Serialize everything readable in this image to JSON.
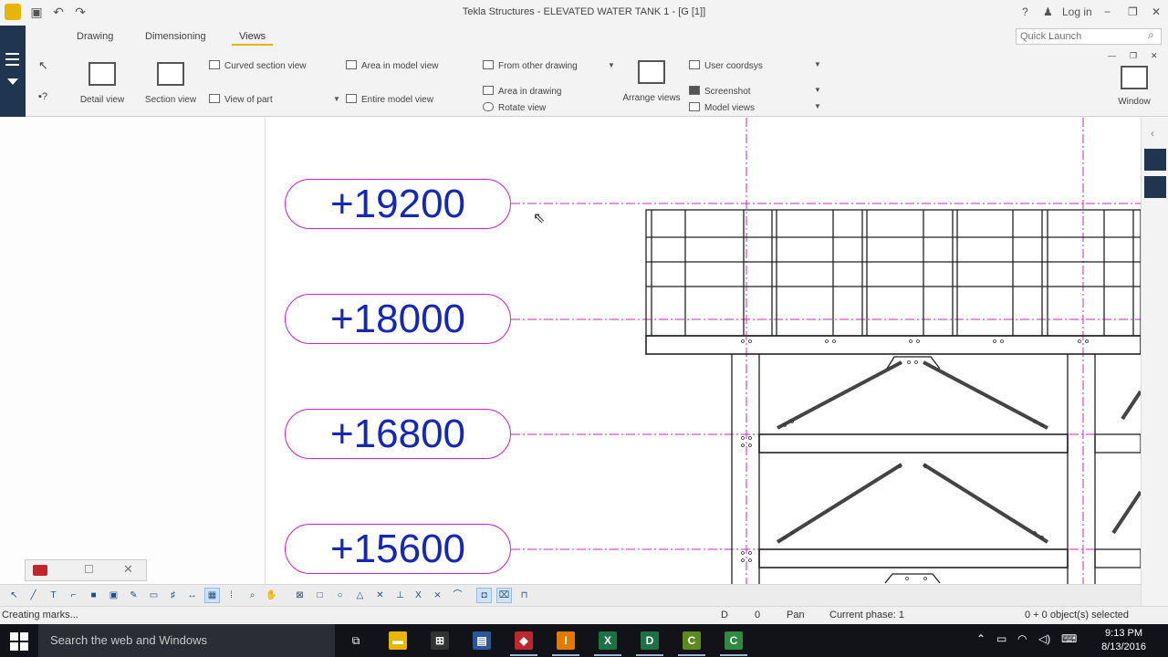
{
  "window": {
    "title": "Tekla Structures - ELEVATED WATER TANK 1 - [G  [1]]",
    "help": "?",
    "login": "Log in"
  },
  "ribbon": {
    "tabs": [
      "Drawing",
      "Dimensioning",
      "Views"
    ],
    "active_tab": "Views",
    "quick_launch_placeholder": "Quick Launch",
    "buttons": {
      "detail_view": "Detail view",
      "section_view": "Section view",
      "curved_section_view": "Curved section view",
      "view_of_part": "View of part",
      "area_in_model_view": "Area in model view",
      "entire_model_view": "Entire model view",
      "from_other_drawing": "From other drawing",
      "area_in_drawing": "Area in drawing",
      "rotate_view": "Rotate view",
      "arrange_views": "Arrange views",
      "user_coordsys": "User coordsys",
      "screenshot": "Screenshot",
      "model_views": "Model views",
      "window": "Window"
    }
  },
  "drawing": {
    "levels": [
      "+19200",
      "+18000",
      "+16800",
      "+15600"
    ],
    "colors": {
      "level_text": "#1428b4",
      "level_border": "#d020c8",
      "gridline": "#d020c8",
      "steel": "#222222"
    }
  },
  "statusbar": {
    "message": "Creating marks...",
    "d_label": "D",
    "d_value": "0",
    "mode": "Pan",
    "phase": "Current phase: 1",
    "selection": "0 + 0 object(s) selected"
  },
  "taskbar": {
    "search_placeholder": "Search the web and Windows",
    "time": "9:13 PM",
    "date": "8/13/2016",
    "apps": [
      {
        "name": "file-explorer",
        "glyph": "▬",
        "color": "#e8b600"
      },
      {
        "name": "store",
        "glyph": "⊞",
        "color": "#333"
      },
      {
        "name": "notepad",
        "glyph": "▤",
        "color": "#2b579a"
      },
      {
        "name": "tekla",
        "glyph": "◆",
        "color": "#c0272d"
      },
      {
        "name": "illustrator",
        "glyph": "I",
        "color": "#e07b00"
      },
      {
        "name": "excel",
        "glyph": "X",
        "color": "#1e7145"
      },
      {
        "name": "app-d",
        "glyph": "D",
        "color": "#1e7145"
      },
      {
        "name": "app-c1",
        "glyph": "C",
        "color": "#5c8a1e"
      },
      {
        "name": "app-c2",
        "glyph": "C",
        "color": "#2d8a3e"
      }
    ]
  }
}
